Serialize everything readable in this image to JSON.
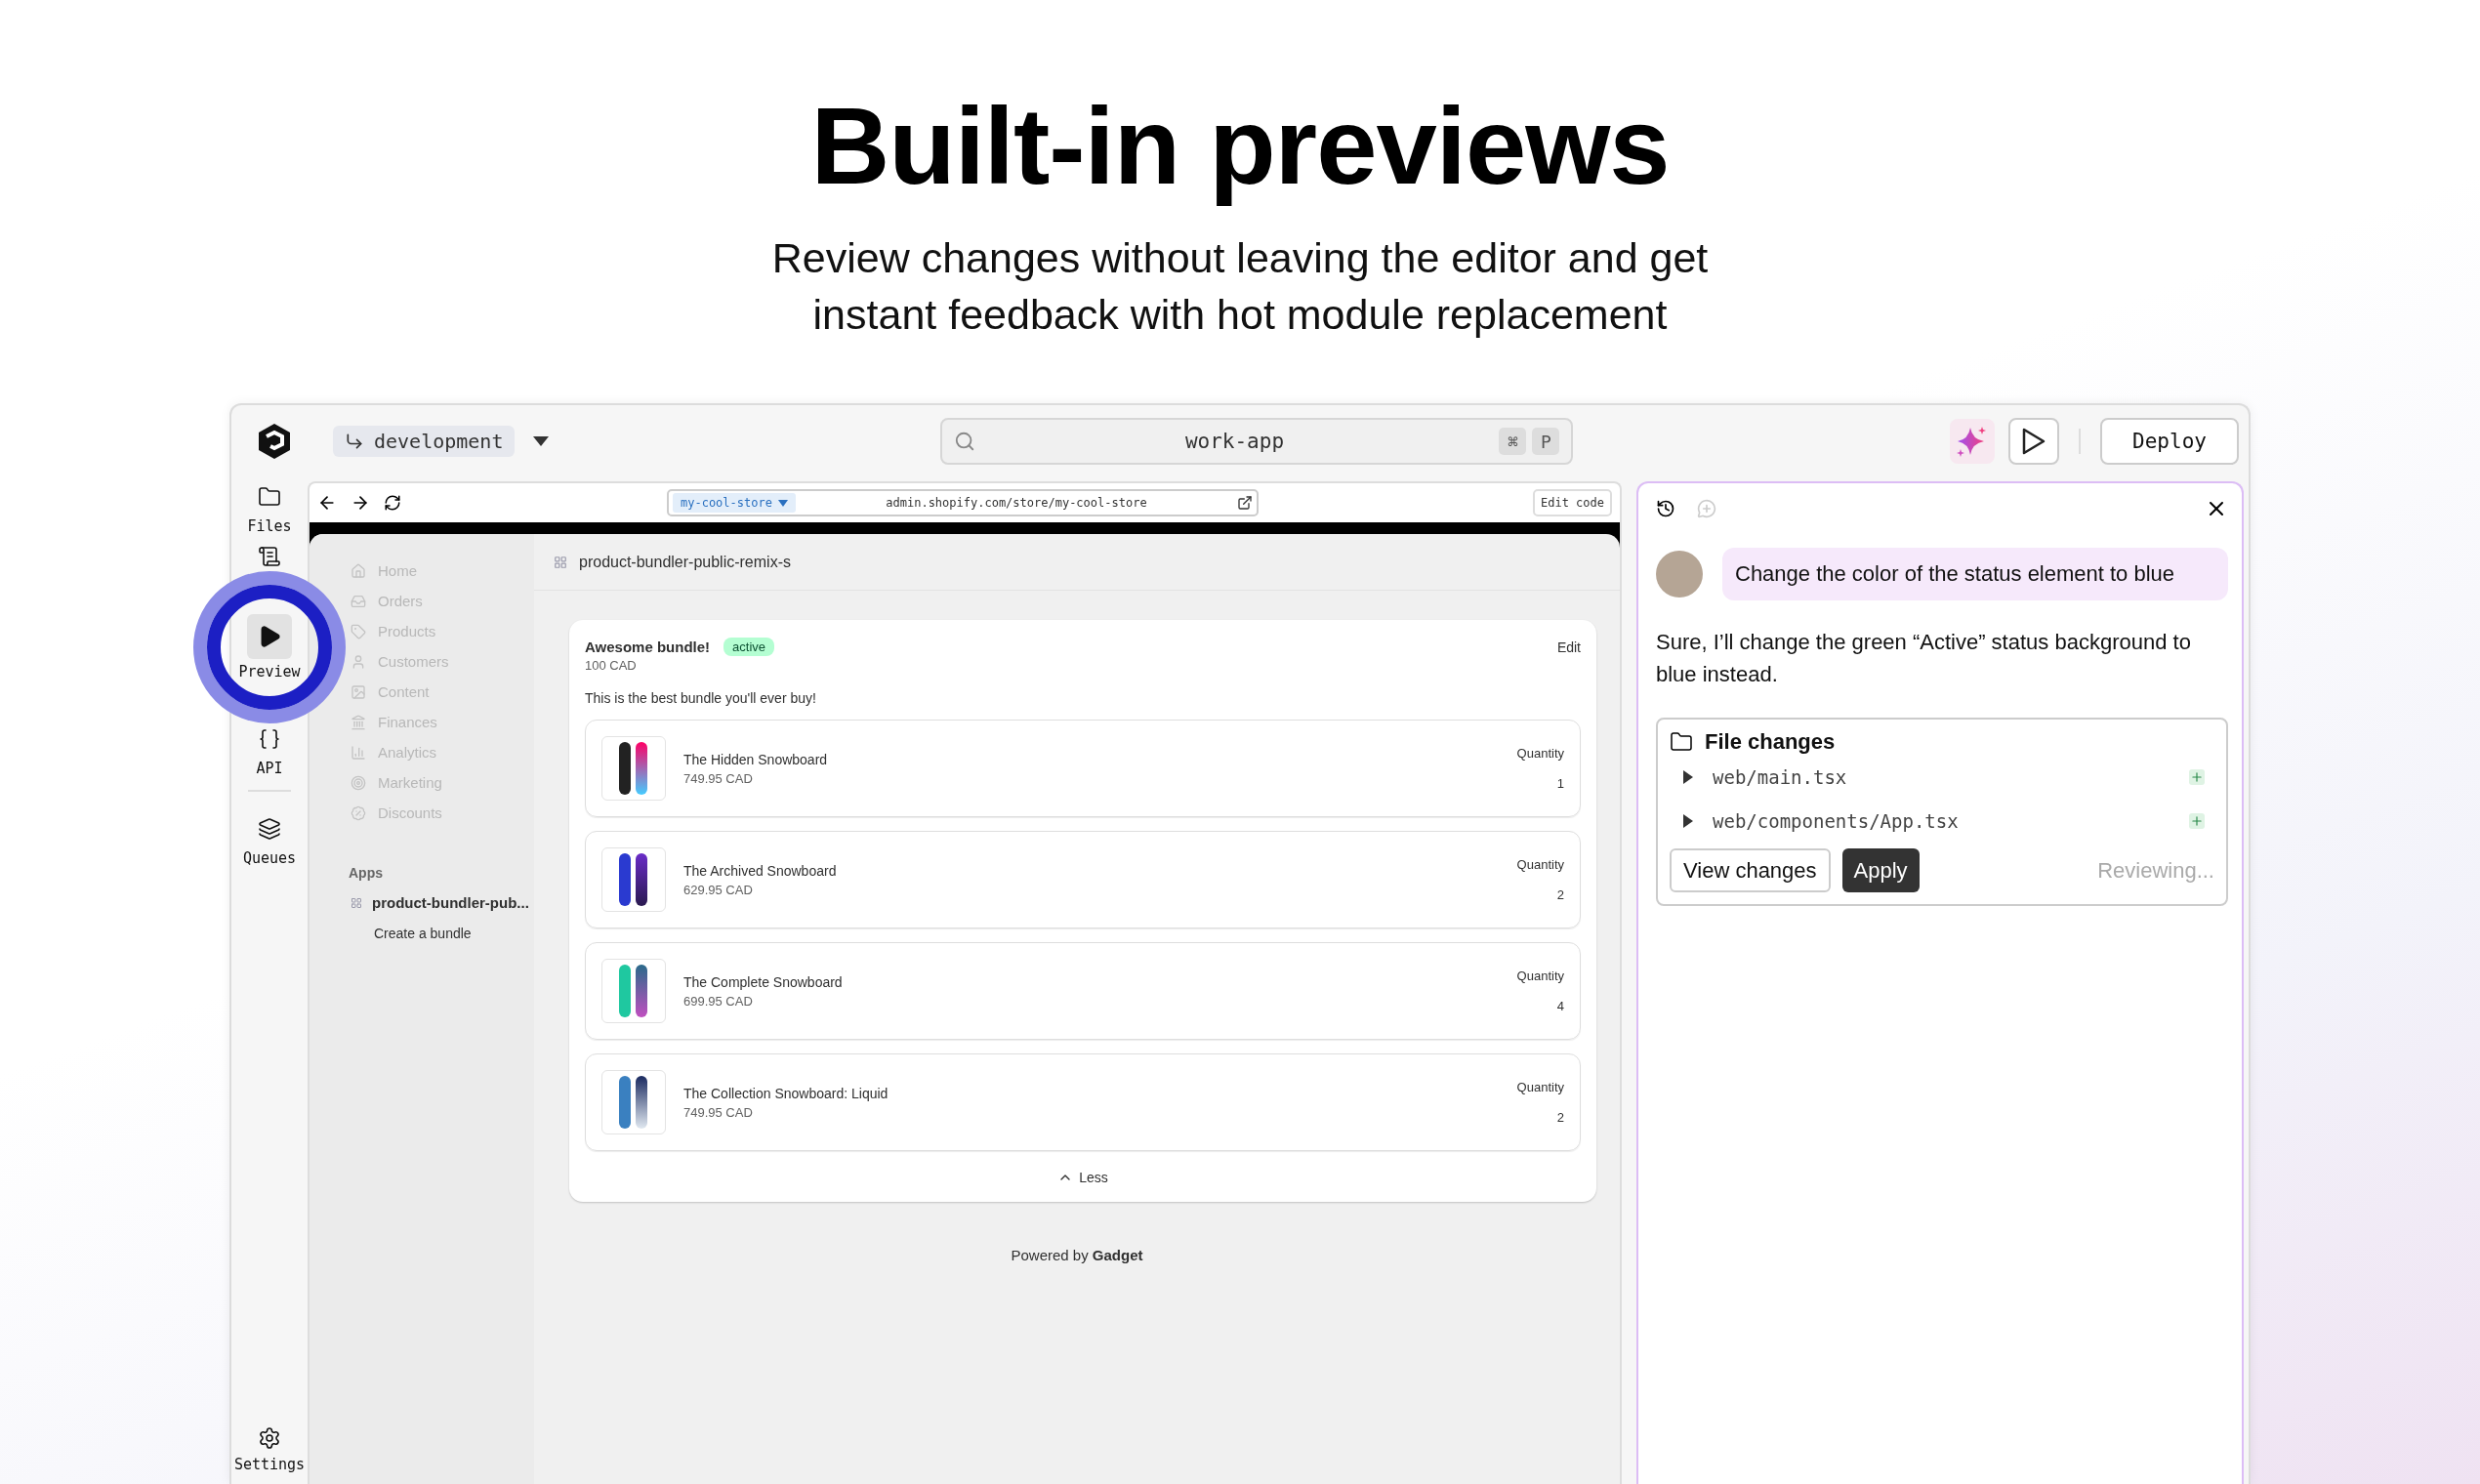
{
  "hero": {
    "title": "Built-in previews",
    "subtitle": "Review changes without leaving the editor and get instant feedback with hot module replacement"
  },
  "topbar": {
    "branch": "development",
    "search": "work-app",
    "shortcut_keys": [
      "⌘",
      "P"
    ],
    "deploy": "Deploy"
  },
  "rail": [
    {
      "label": "Files",
      "selected": false
    },
    {
      "selected": false
    },
    {
      "label": "Preview",
      "selected": true
    },
    {
      "label": "API",
      "selected": false
    },
    {
      "label": "Queues",
      "selected": false
    }
  ],
  "rail_settings": "Settings",
  "browser": {
    "store": "my-cool-store",
    "url": "admin.shopify.com/store/my-cool-store",
    "edit_button": "Edit code"
  },
  "admin_nav": [
    {
      "label": "Home",
      "disabled": true
    },
    {
      "label": "Orders",
      "disabled": true
    },
    {
      "label": "Products",
      "disabled": true
    },
    {
      "label": "Customers",
      "disabled": true
    },
    {
      "label": "Content",
      "disabled": true
    },
    {
      "label": "Finances",
      "disabled": true
    },
    {
      "label": "Analytics",
      "disabled": true
    },
    {
      "label": "Marketing",
      "disabled": true
    },
    {
      "label": "Discounts",
      "disabled": true
    }
  ],
  "apps": {
    "heading": "Apps",
    "app": "product-bundler-pub...",
    "subitem": "Create a bundle"
  },
  "page_title": "product-bundler-public-remix-s",
  "bundle": {
    "name": "Awesome bundle!",
    "status": "active",
    "price": "100 CAD",
    "edit": "Edit",
    "description": "This is the best bundle you'll ever buy!",
    "products": [
      {
        "name": "The Hidden Snowboard",
        "price": "749.95 CAD",
        "quantity_label": "Quantity",
        "quantity": "1"
      },
      {
        "name": "The Archived Snowboard",
        "price": "629.95 CAD",
        "quantity_label": "Quantity",
        "quantity": "2"
      },
      {
        "name": "The Complete Snowboard",
        "price": "699.95 CAD",
        "quantity_label": "Quantity",
        "quantity": "4"
      },
      {
        "name": "The Collection Snowboard: Liquid",
        "price": "749.95 CAD",
        "quantity_label": "Quantity",
        "quantity": "2"
      }
    ],
    "less": "Less"
  },
  "footer": "Powered by **Gadget**",
  "chat": {
    "user_message": "Change the color of the status element to blue",
    "reply": "Sure, I’ll change the green “Active” status background to blue instead.",
    "file_changes": {
      "title": "File changes",
      "files": [
        {
          "path": "web/main.tsx",
          "expanded": false
        },
        {
          "path": "web/components/App.tsx",
          "expanded": false
        }
      ]
    },
    "view_button": "View changes",
    "apply_button": "Apply",
    "status": "Reviewing..."
  }
}
